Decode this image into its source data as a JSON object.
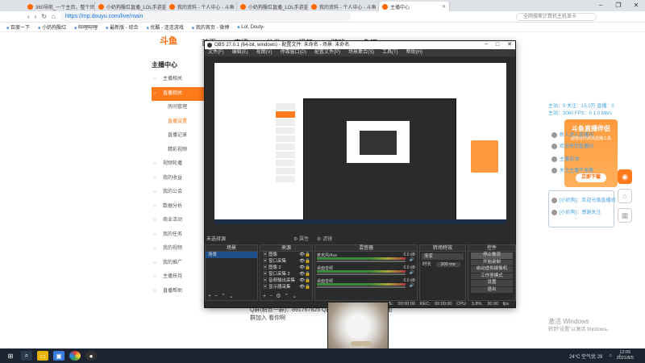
{
  "browser": {
    "tabs": [
      {
        "label": "360导航_一个主页，整个世界",
        "active": false
      },
      {
        "label": "小奶狗殷红直播_LOL手游直播",
        "active": false
      },
      {
        "label": "我的资料 - 个人中心 - 斗鱼",
        "active": false
      },
      {
        "label": "小奶狗殷红直播_LOL手游直播",
        "active": false
      },
      {
        "label": "我的资料 - 个人中心 - 斗鱼",
        "active": false
      },
      {
        "label": "主播中心",
        "active": true
      }
    ],
    "url": "https://mp.douyu.com/live/main",
    "search_placeholder": "全网搜索计算机主机显卡",
    "bookmarks": [
      "百度一下",
      "小奶狗殷红",
      "哔哩哔哩",
      "最新版 - 综合",
      "优酷 - 连连游戏",
      "我的首页 - 微博",
      "Lol, Douty-"
    ],
    "window_controls": [
      "−",
      "❐",
      "✕"
    ]
  },
  "douyu": {
    "logo": "斗鱼",
    "nav": [
      "首页",
      "直播",
      "分类",
      "视频",
      "游戏",
      "鱼吧"
    ],
    "sidebar_title": "主播中心",
    "sidebar": [
      {
        "label": "主播相关",
        "type": "item"
      },
      {
        "label": "直播相关",
        "type": "active"
      },
      {
        "label": "房间管理",
        "type": "sub"
      },
      {
        "label": "直播设置",
        "type": "sub-hl"
      },
      {
        "label": "直播记录",
        "type": "sub"
      },
      {
        "label": "精彩视频",
        "type": "sub"
      },
      {
        "label": "视频轮播",
        "type": "item"
      },
      {
        "label": "我的收益",
        "type": "item"
      },
      {
        "label": "我的公会",
        "type": "item"
      },
      {
        "label": "数据分析",
        "type": "item"
      },
      {
        "label": "商业活动",
        "type": "item"
      },
      {
        "label": "我的任务",
        "type": "item"
      },
      {
        "label": "我的视频",
        "type": "item"
      },
      {
        "label": "我的推广",
        "type": "item"
      },
      {
        "label": "主播扶持",
        "type": "item"
      },
      {
        "label": "直播帮助",
        "type": "item"
      }
    ],
    "stats": [
      "主站：0   关注：15.0万   直播：0",
      "主站：3060   FPS：0   1.0 Mb/s"
    ],
    "banner_title": "斗鱼直播伴侣",
    "banner_sub": "超低延时高清直播工具",
    "banner_button": "立即下载",
    "chat_lines": [
      "新人进入直播间",
      "欢迎来到直播间",
      "主播加油",
      "关注主播不迷路"
    ],
    "chatbox_lines": [
      "[小奶狗]：欢迎光临直播间",
      "[小奶狗]：感谢关注"
    ],
    "qq_group": "Q群(粉丝一群)：891767825  Q群(粉丝二群)：欢迎大家加",
    "qq_group2": "群加入 看你啊"
  },
  "obs": {
    "title": "OBS 27.0.1 (64-bit, windows) - 配置文件: 未命名 - 场景: 未命名",
    "menu": [
      "文件(F)",
      "编辑(E)",
      "视图(V)",
      "停靠窗口(D)",
      "配置文件(P)",
      "场景集合(S)",
      "工具(T)",
      "帮助(H)"
    ],
    "scene_label": "未选择源",
    "scene_tools": [
      "⚙ 属性",
      "⚙ 滤镜"
    ],
    "docks": {
      "scenes": {
        "title": "场景",
        "items": [
          "场景"
        ]
      },
      "sources": {
        "title": "来源",
        "items": [
          "图像",
          "窗口采集",
          "图像 2",
          "窗口采集 2",
          "音频输出采集",
          "显示器采集"
        ]
      },
      "mixer": {
        "title": "混音器",
        "channels": [
          {
            "name": "麦克风/Aux",
            "level": "0.0 dB"
          },
          {
            "name": "桌面音频",
            "level": "0.0 dB"
          },
          {
            "name": "桌面音频",
            "level": "0.0 dB"
          }
        ]
      },
      "transitions": {
        "title": "转场特效",
        "type": "渐变",
        "duration_label": "时长",
        "duration": "300 ms"
      },
      "controls": {
        "title": "控件",
        "buttons": [
          "停止推流",
          "开始录制",
          "启动虚拟摄像机",
          "工作室模式",
          "设置",
          "退出"
        ]
      }
    },
    "status": "LIVE: 00:00:00   REC: 00:00:00   CPU: 3.8%, 30.00 fps"
  },
  "desktop": {
    "activate_title": "激活 Windows",
    "activate_sub": "转到\"设置\"以激活 Windows。",
    "weather": "24°C 空气优 29",
    "time": "12:05",
    "date": "2021/8/5"
  },
  "colors": {
    "douyu_orange": "#ff7a1a",
    "obs_bg": "#2b2b2b",
    "taskbar": "#1b2430"
  }
}
